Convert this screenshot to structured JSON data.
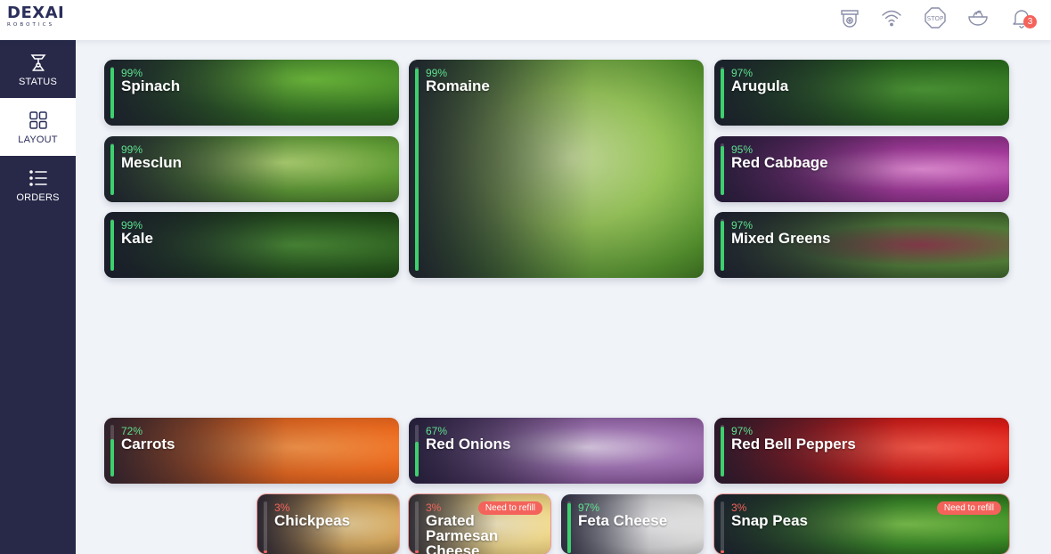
{
  "brand": {
    "logo_main": "DEXAI",
    "logo_sub": "ROBOTICS"
  },
  "header": {
    "icons": [
      "robot-icon",
      "wifi-icon",
      "stop-icon",
      "bowl-icon",
      "bell-icon"
    ],
    "stop_label": "STOP",
    "notification_count": "3"
  },
  "sidebar": {
    "items": [
      {
        "label": "STATUS",
        "icon": "robot-arm-icon"
      },
      {
        "label": "LAYOUT",
        "icon": "grid-icon",
        "active": true
      },
      {
        "label": "ORDERS",
        "icon": "list-icon"
      }
    ]
  },
  "colors": {
    "nav_bg": "#282949",
    "accent_green": "#3ecf6e",
    "alert_red": "#f4635b",
    "page_bg": "#f0f3f8"
  },
  "bins": [
    {
      "name": "Spinach",
      "percent": "99%",
      "level": 0.99,
      "texture": "t-spinach"
    },
    {
      "name": "Mesclun",
      "percent": "99%",
      "level": 0.99,
      "texture": "t-mesclun"
    },
    {
      "name": "Kale",
      "percent": "99%",
      "level": 0.99,
      "texture": "t-kale"
    },
    {
      "name": "Romaine",
      "percent": "99%",
      "level": 0.99,
      "texture": "t-romaine"
    },
    {
      "name": "Arugula",
      "percent": "97%",
      "level": 0.97,
      "texture": "t-arugula"
    },
    {
      "name": "Red Cabbage",
      "percent": "95%",
      "level": 0.95,
      "texture": "t-redcabbage"
    },
    {
      "name": "Mixed Greens",
      "percent": "97%",
      "level": 0.97,
      "texture": "t-mixed"
    },
    {
      "name": "Carrots",
      "percent": "72%",
      "level": 0.72,
      "texture": "t-carrots"
    },
    {
      "name": "Red Onions",
      "percent": "67%",
      "level": 0.67,
      "texture": "t-onions"
    },
    {
      "name": "Red Bell Peppers",
      "percent": "97%",
      "level": 0.97,
      "texture": "t-peppers"
    },
    {
      "name": "Chickpeas",
      "percent": "3%",
      "level": 0.03,
      "texture": "t-chickpeas",
      "low": true
    },
    {
      "name": "Grated Parmesan Cheese",
      "percent": "3%",
      "level": 0.03,
      "texture": "t-parmesan",
      "low": true,
      "refill_label": "Need to refill"
    },
    {
      "name": "Feta Cheese",
      "percent": "97%",
      "level": 0.97,
      "texture": "t-feta"
    },
    {
      "name": "Snap Peas",
      "percent": "3%",
      "level": 0.03,
      "texture": "t-snappeas",
      "low": true,
      "refill_label": "Need to refill"
    }
  ]
}
